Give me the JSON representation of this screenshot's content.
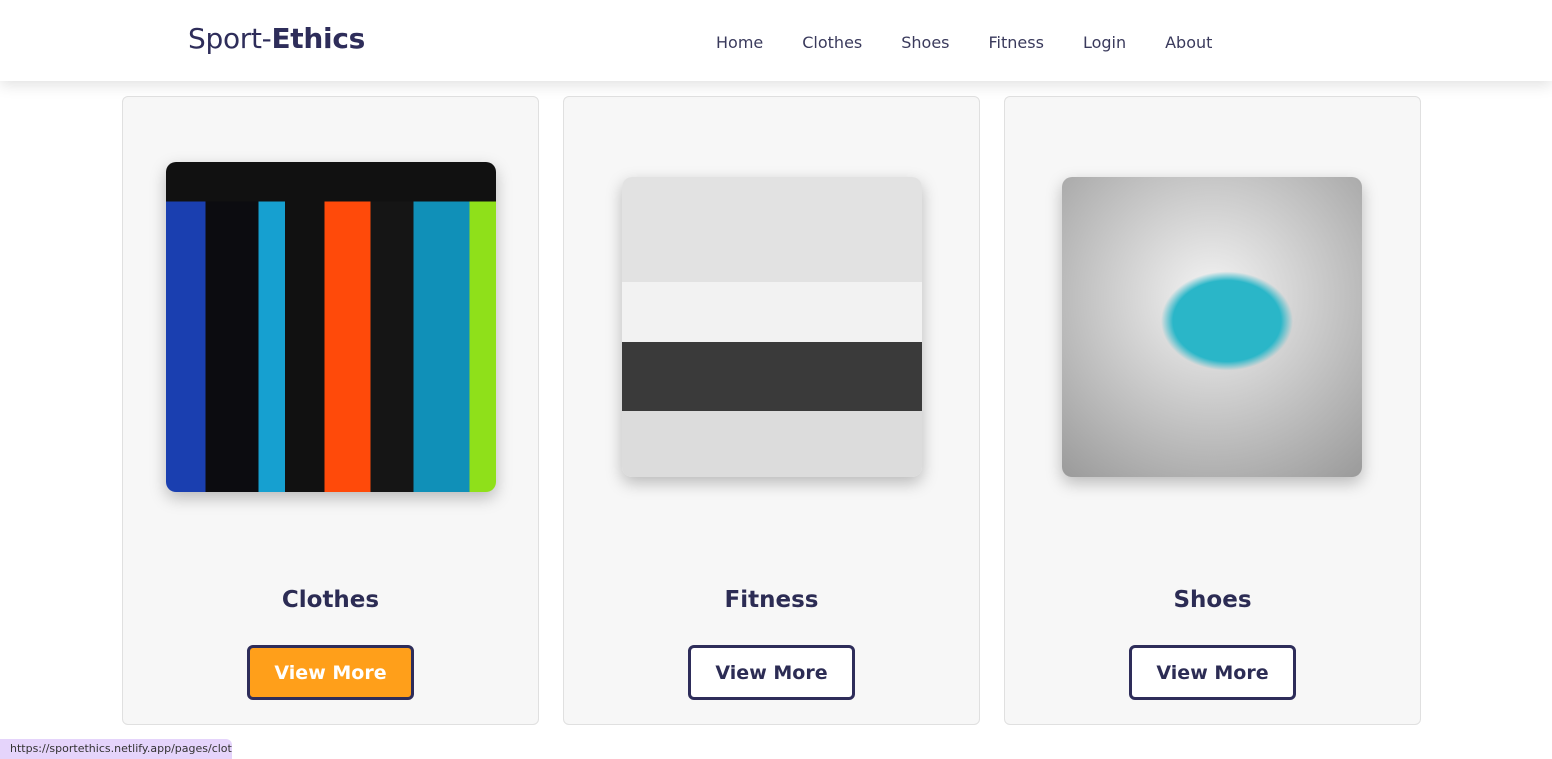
{
  "header": {
    "logo_light": "Sport-",
    "logo_bold": "Ethics",
    "nav": [
      "Home",
      "Clothes",
      "Shoes",
      "Fitness",
      "Login",
      "About"
    ]
  },
  "cards": [
    {
      "title": "Clothes",
      "button": "View More",
      "image": "clothes-rack-photo"
    },
    {
      "title": "Fitness",
      "button": "View More",
      "image": "gym-photo"
    },
    {
      "title": "Shoes",
      "button": "View More",
      "image": "sneaker-photo"
    }
  ],
  "status_bar": {
    "url": "https://sportethics.netlify.app/pages/clothing"
  },
  "colors": {
    "accent": "#ff9f1a",
    "primary": "#2e2d5a"
  }
}
